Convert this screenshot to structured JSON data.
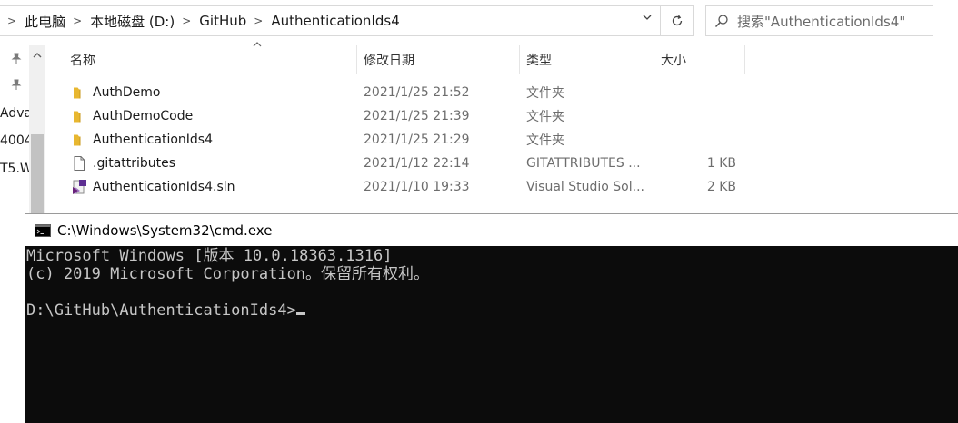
{
  "explorer": {
    "breadcrumb": [
      "此电脑",
      "本地磁盘 (D:)",
      "GitHub",
      "AuthenticationIds4"
    ],
    "search": {
      "placeholder": "搜索\"AuthenticationIds4\""
    },
    "nav_pane": {
      "items": [
        "Adva",
        "4004",
        "T5.W"
      ]
    },
    "columns": {
      "name": "名称",
      "date": "修改日期",
      "type": "类型",
      "size": "大小"
    },
    "files": [
      {
        "name": "AuthDemo",
        "date": "2021/1/25 21:52",
        "type": "文件夹",
        "size": "",
        "icon": "folder-icon"
      },
      {
        "name": "AuthDemoCode",
        "date": "2021/1/25 21:39",
        "type": "文件夹",
        "size": "",
        "icon": "folder-icon"
      },
      {
        "name": "AuthenticationIds4",
        "date": "2021/1/25 21:29",
        "type": "文件夹",
        "size": "",
        "icon": "folder-icon"
      },
      {
        "name": ".gitattributes",
        "date": "2021/1/12 22:14",
        "type": "GITATTRIBUTES ...",
        "size": "1 KB",
        "icon": "file-icon"
      },
      {
        "name": "AuthenticationIds4.sln",
        "date": "2021/1/10 19:33",
        "type": "Visual Studio Sol...",
        "size": "2 KB",
        "icon": "visual-studio-solution-icon"
      }
    ],
    "colors": {
      "folder": "#e8b730",
      "border": "#d9d9d9"
    }
  },
  "cmd": {
    "title": "C:\\Windows\\System32\\cmd.exe",
    "lines": [
      "Microsoft Windows [版本 10.0.18363.1316]",
      "(c) 2019 Microsoft Corporation。保留所有权利。",
      "",
      "D:\\GitHub\\AuthenticationIds4>"
    ],
    "colors": {
      "background": "#0c0c0c",
      "text": "#c7c7c7"
    }
  }
}
